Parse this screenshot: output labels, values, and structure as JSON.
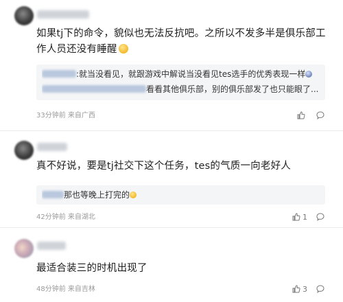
{
  "comments": [
    {
      "text": "如果tj下的命令，貌似也无法反抗吧。之所以不发多半是俱乐部工作人员还没有睡醒",
      "replies": [
        {
          "text": ":就当没看见，就跟游戏中解说当没看见tes选手的优秀表现一样"
        },
        {
          "text": "看看其他俱乐部，别的俱乐部发了也只能眼了..."
        }
      ],
      "meta": "33分钟前 来自广西",
      "like_count": "",
      "icons": [
        "thumb-up-icon",
        "comment-bubble-icon"
      ]
    },
    {
      "text": "真不好说，要是tj社交下这个任务，tes的气质一向老好人",
      "replies": [
        {
          "text": "那也等晚上打完的"
        }
      ],
      "meta": "42分钟前 来自湖北",
      "like_count": "1",
      "icons": [
        "thumb-up-icon",
        "comment-bubble-icon"
      ]
    },
    {
      "text": "最适合装三的时机出现了",
      "replies": [],
      "meta": "48分钟前 来自吉林",
      "like_count": "3",
      "icons": [
        "thumb-up-icon",
        "comment-bubble-icon"
      ]
    }
  ],
  "colors": {
    "background": "#ffffff",
    "reply_background": "#f4f5f7",
    "meta_text": "#9a9a9a",
    "divider": "#e9e9e9"
  }
}
